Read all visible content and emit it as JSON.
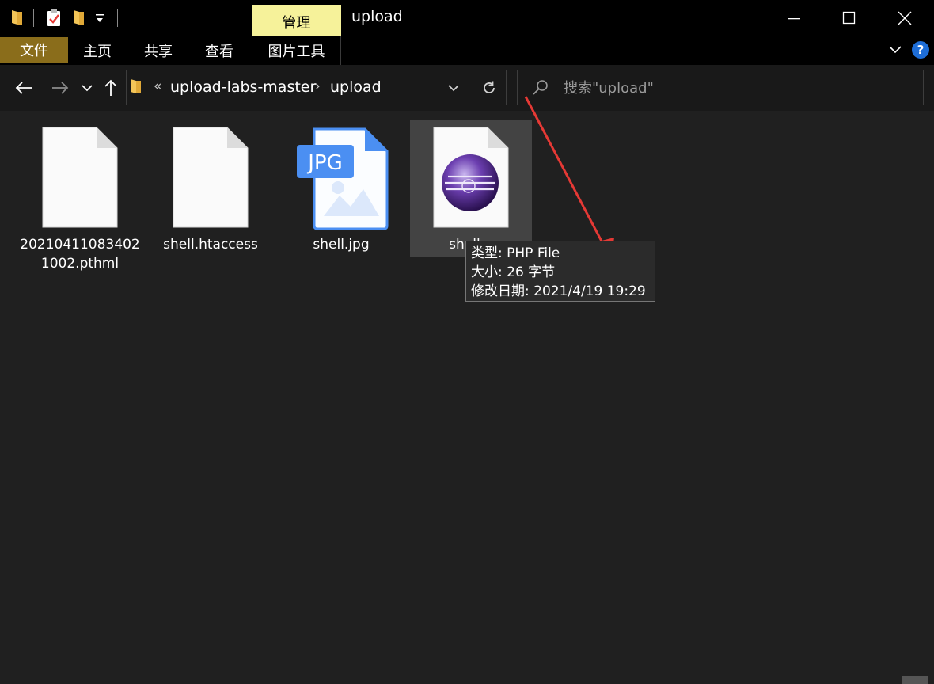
{
  "window": {
    "title": "upload",
    "manage_tab": "管理"
  },
  "ribbon": {
    "tabs": [
      "文件",
      "主页",
      "共享",
      "查看",
      "图片工具"
    ],
    "help": "?"
  },
  "address": {
    "overflow": "«",
    "crumbs": [
      "upload-labs-master",
      "upload"
    ],
    "separator": "›"
  },
  "search": {
    "placeholder": "搜索\"upload\""
  },
  "files": [
    {
      "name": "202104110834021002.pthml",
      "icon": "blank-file-icon"
    },
    {
      "name": "shell.htaccess",
      "icon": "blank-file-icon"
    },
    {
      "name": "shell.jpg",
      "icon": "jpg-file-icon",
      "badge": "JPG"
    },
    {
      "name": "shell.php",
      "visible_name": "shell.p",
      "icon": "php-file-icon",
      "selected": true
    }
  ],
  "tooltip": {
    "type": "类型: PHP File",
    "size": "大小: 26 字节",
    "modified": "修改日期: 2021/4/19 19:29"
  },
  "colors": {
    "manage_tab": "#f6f29a",
    "file_tab": "#8a6d1b",
    "annotation_arrow": "#e53935",
    "help": "#1e6ed8"
  }
}
